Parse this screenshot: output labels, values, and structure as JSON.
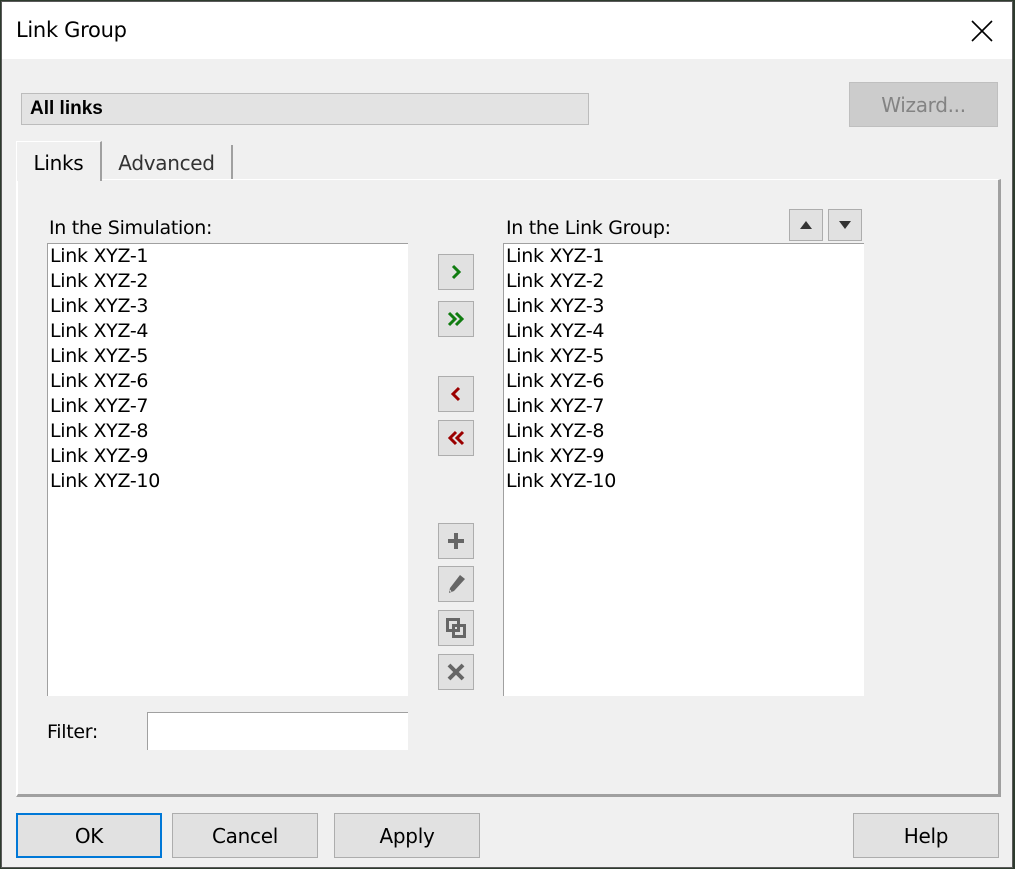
{
  "window": {
    "title": "Link Group",
    "close_icon": "close-icon"
  },
  "header": {
    "group_name": "All links",
    "wizard_label": "Wizard..."
  },
  "tabs": [
    {
      "label": "Links",
      "active": true
    },
    {
      "label": "Advanced",
      "active": false
    }
  ],
  "links_tab": {
    "simulation_label": "In the Simulation:",
    "group_label": "In the Link Group:",
    "simulation_items": [
      "Link XYZ-1",
      "Link XYZ-2",
      "Link XYZ-3",
      "Link XYZ-4",
      "Link XYZ-5",
      "Link XYZ-6",
      "Link XYZ-7",
      "Link XYZ-8",
      "Link XYZ-9",
      "Link XYZ-10"
    ],
    "group_items": [
      "Link XYZ-1",
      "Link XYZ-2",
      "Link XYZ-3",
      "Link XYZ-4",
      "Link XYZ-5",
      "Link XYZ-6",
      "Link XYZ-7",
      "Link XYZ-8",
      "Link XYZ-9",
      "Link XYZ-10"
    ],
    "transfer_buttons": [
      {
        "name": "add-selected-button",
        "icon": "chevron-right-icon",
        "color": "#107c10"
      },
      {
        "name": "add-all-button",
        "icon": "double-chevron-right-icon",
        "color": "#107c10"
      },
      {
        "name": "remove-selected-button",
        "icon": "chevron-left-icon",
        "color": "#9b0000"
      },
      {
        "name": "remove-all-button",
        "icon": "double-chevron-left-icon",
        "color": "#9b0000"
      }
    ],
    "edit_buttons": [
      {
        "name": "new-link-button",
        "icon": "plus-icon"
      },
      {
        "name": "edit-link-button",
        "icon": "pencil-icon"
      },
      {
        "name": "duplicate-link-button",
        "icon": "duplicate-icon"
      },
      {
        "name": "delete-link-button",
        "icon": "delete-x-icon"
      }
    ],
    "move_up_icon": "triangle-up-icon",
    "move_down_icon": "triangle-down-icon",
    "filter_label": "Filter:",
    "filter_value": "",
    "icon_gray": "#666666"
  },
  "footer": {
    "ok_label": "OK",
    "cancel_label": "Cancel",
    "apply_label": "Apply",
    "help_label": "Help"
  },
  "colors": {
    "accent_focus": "#0078d7",
    "dialog_bg": "#f0f0f0"
  }
}
